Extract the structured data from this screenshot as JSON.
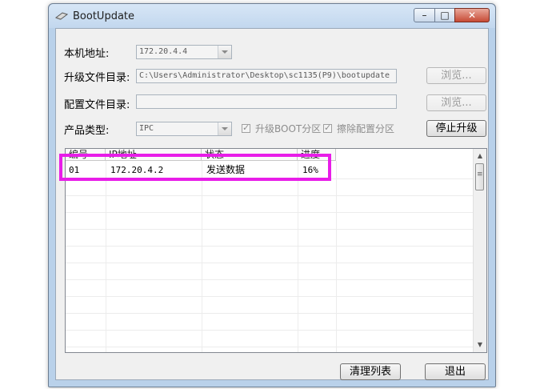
{
  "window": {
    "title": "BootUpdate",
    "buttons": {
      "minimize": "–",
      "maximize": "□",
      "close": "✕"
    }
  },
  "form": {
    "local_address_label": "本机地址:",
    "local_address_value": "172.20.4.4",
    "upgrade_dir_label": "升级文件目录:",
    "upgrade_dir_value": "C:\\Users\\Administrator\\Desktop\\sc1135(P9)\\bootupdate",
    "config_dir_label": "配置文件目录:",
    "config_dir_value": "",
    "browse_label": "浏览...",
    "product_type_label": "产品类型:",
    "product_type_value": "IPC",
    "upgrade_boot_label": "升级BOOT分区",
    "upgrade_boot_checked": true,
    "erase_config_label": "擦除配置分区",
    "erase_config_checked": true,
    "stop_upgrade_label": "停止升级"
  },
  "list": {
    "columns": [
      "编号",
      "IP地址",
      "状态",
      "进度"
    ],
    "rows": [
      {
        "id": "01",
        "ip": "172.20.4.2",
        "status": "发送数据",
        "progress": "16%"
      }
    ]
  },
  "footer": {
    "clear_list_label": "清理列表",
    "exit_label": "退出"
  },
  "colors": {
    "highlight": "#e81de8",
    "window_frame": "#b9d1ea",
    "client_bg": "#f0f0f0"
  }
}
